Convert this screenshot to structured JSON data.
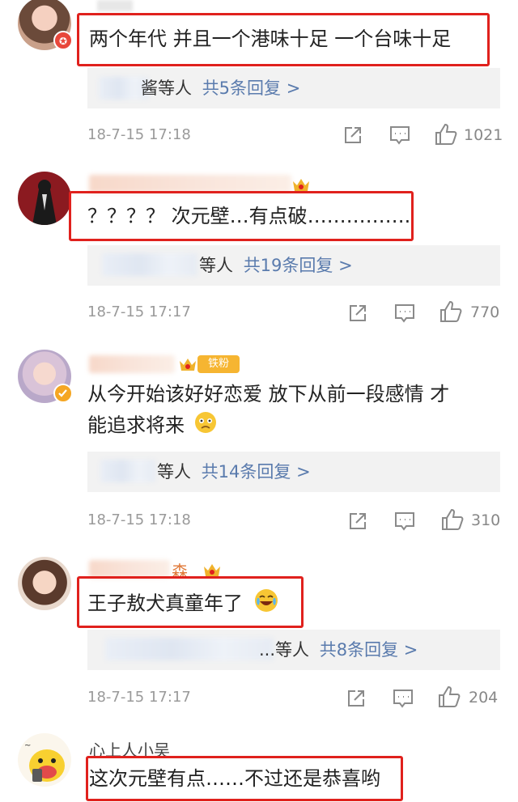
{
  "comments": [
    {
      "text": "两个年代 并且一个港味十足 一个台味十足",
      "reply_suffix": "酱等人",
      "reply_count": "共5条回复 >",
      "time": "18-7-15 17:18",
      "likes": "1021"
    },
    {
      "text": "？？？？ 次元壁…有点破…………….",
      "reply_suffix": "等人",
      "reply_count": "共19条回复 >",
      "time": "18-7-15 17:17",
      "likes": "770"
    },
    {
      "fan_badge": "铁粉",
      "text_line1": "从今开始该好好恋爱 放下从前一段感情 才",
      "text_line2": "能追求将来",
      "reply_suffix": "等人",
      "reply_count": "共14条回复 >",
      "time": "18-7-15 17:18",
      "likes": "310"
    },
    {
      "name_tail": "森",
      "text": "王子敖犬真童年了",
      "reply_suffix": "...等人",
      "reply_count": "共8条回复 >",
      "time": "18-7-15 17:17",
      "likes": "204"
    },
    {
      "username": "心上人小吴",
      "text": "这次元壁有点……不过还是恭喜哟"
    }
  ],
  "icons": {
    "share": "share-icon",
    "comment": "comment-icon",
    "like": "like-icon",
    "crown": "crown-badge-icon",
    "emoji_worried": "worried-face-emoji",
    "emoji_laugh": "laughing-tears-emoji"
  },
  "colors": {
    "highlight_box": "#e0211d",
    "reply_link": "#5a7bad",
    "meta_gray": "#9a9a9a",
    "reply_bg": "#f2f2f2",
    "crown": "#f0b22b"
  }
}
